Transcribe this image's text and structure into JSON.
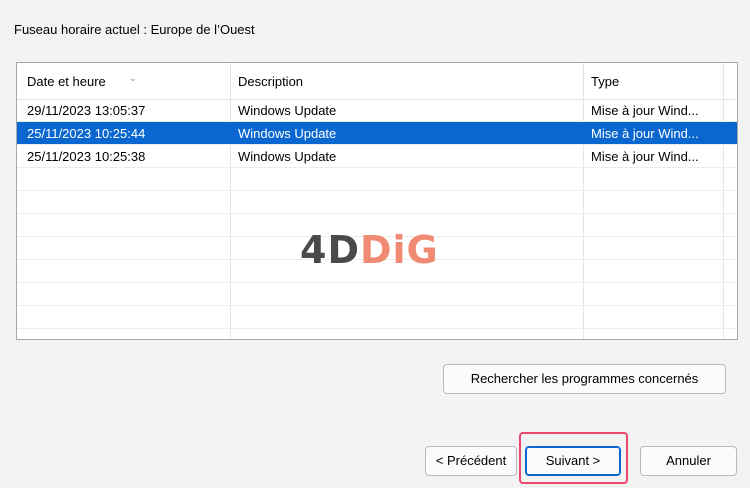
{
  "timezone_label": "Fuseau horaire actuel : Europe de l’Ouest",
  "table": {
    "columns": [
      "Date et heure",
      "Description",
      "Type"
    ],
    "rows": [
      {
        "date": "29/11/2023 13:05:37",
        "description": "Windows Update",
        "type": "Mise à jour Wind...",
        "selected": false
      },
      {
        "date": "25/11/2023 10:25:44",
        "description": "Windows Update",
        "type": "Mise à jour Wind...",
        "selected": true
      },
      {
        "date": "25/11/2023 10:25:38",
        "description": "Windows Update",
        "type": "Mise à jour Wind...",
        "selected": false
      }
    ],
    "sort_icon": "chevron-down-icon"
  },
  "watermark": {
    "part1": "4D",
    "part2": "DiG"
  },
  "buttons": {
    "find_programs": "Rechercher les programmes concernés",
    "previous": "< Précédent",
    "next": "Suivant >",
    "cancel": "Annuler"
  },
  "colors": {
    "selection": "#0a67d0",
    "highlight": "#e8486b",
    "watermark_dark": "#4a4a4a",
    "watermark_accent": "#f08a72"
  }
}
